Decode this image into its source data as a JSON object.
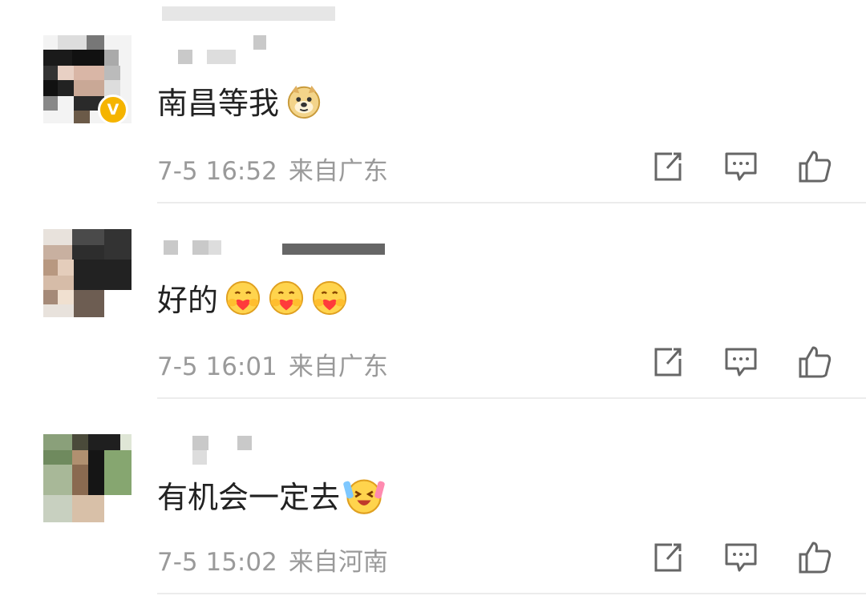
{
  "colors": {
    "text": "#222222",
    "meta": "#9a9a9a",
    "icon": "#666666",
    "badge": "#f5b400",
    "divider": "#ececec"
  },
  "comments": [
    {
      "text": "南昌等我",
      "emoji": [
        "doge-face"
      ],
      "date": "7-5 16:52",
      "location": "来自广东",
      "verified": true,
      "badge_letter": "V"
    },
    {
      "text": "好的",
      "emoji": [
        "hug-face",
        "hug-face",
        "hug-face"
      ],
      "date": "7-5 16:01",
      "location": "来自广东",
      "verified": false
    },
    {
      "text": "有机会一定去",
      "emoji": [
        "excited-face"
      ],
      "date": "7-5 15:02",
      "location": "来自河南",
      "verified": false
    }
  ]
}
